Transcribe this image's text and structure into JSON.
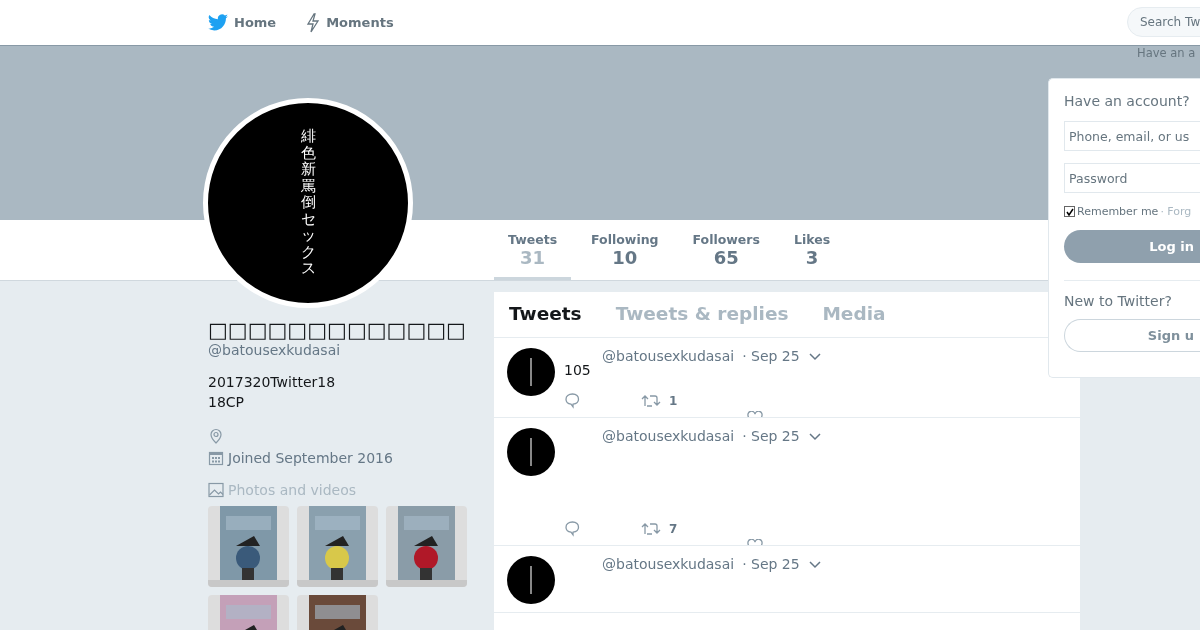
{
  "nav": {
    "items": [
      {
        "label": "Home",
        "kind": "home"
      },
      {
        "label": "Moments",
        "kind": "moments"
      }
    ]
  },
  "search": {
    "placeholder": "Search Tw"
  },
  "login_hint": "Have an a",
  "profile": {
    "avatar_text": "緋色新罵倒セックス",
    "name": "□□□□□□□□□□□□□",
    "handle": "@batousexkudasai",
    "bio": [
      "2017320Twitter18",
      "18CP"
    ],
    "joined": "Joined September 2016",
    "media_heading": "Photos and videos",
    "photos": [
      {
        "kind": "picture"
      },
      {
        "kind": "picture"
      },
      {
        "kind": "picture"
      },
      {
        "kind": "picture"
      },
      {
        "kind": "picture"
      }
    ]
  },
  "stats": [
    {
      "label": "Tweets",
      "value": "31",
      "selected": true
    },
    {
      "label": "Following",
      "value": "10",
      "selected": false
    },
    {
      "label": "Followers",
      "value": "65",
      "selected": false
    },
    {
      "label": "Likes",
      "value": "3",
      "selected": false
    }
  ],
  "timeline_tabs": [
    {
      "label": "Tweets",
      "selected": true
    },
    {
      "label": "Tweets & replies",
      "selected": false
    },
    {
      "label": "Media",
      "selected": false
    }
  ],
  "tweets": [
    {
      "handle": "@batousexkudasai",
      "time": "· Sep 25",
      "text": "105",
      "retweets": "1"
    },
    {
      "handle": "@batousexkudasai",
      "time": "· Sep 25",
      "retweets": "7"
    },
    {
      "handle": "@batousexkudasai",
      "time": "· Sep 25"
    }
  ],
  "login": {
    "title": "Have an account?",
    "username_placeholder": "Phone, email, or us",
    "password_placeholder": "Password",
    "remember": {
      "label": "Remember me",
      "checked": true
    },
    "forgot": "· Forg",
    "login_button": "Log in",
    "signup_title": "New to Twitter?",
    "signup_button": "Sign u"
  }
}
